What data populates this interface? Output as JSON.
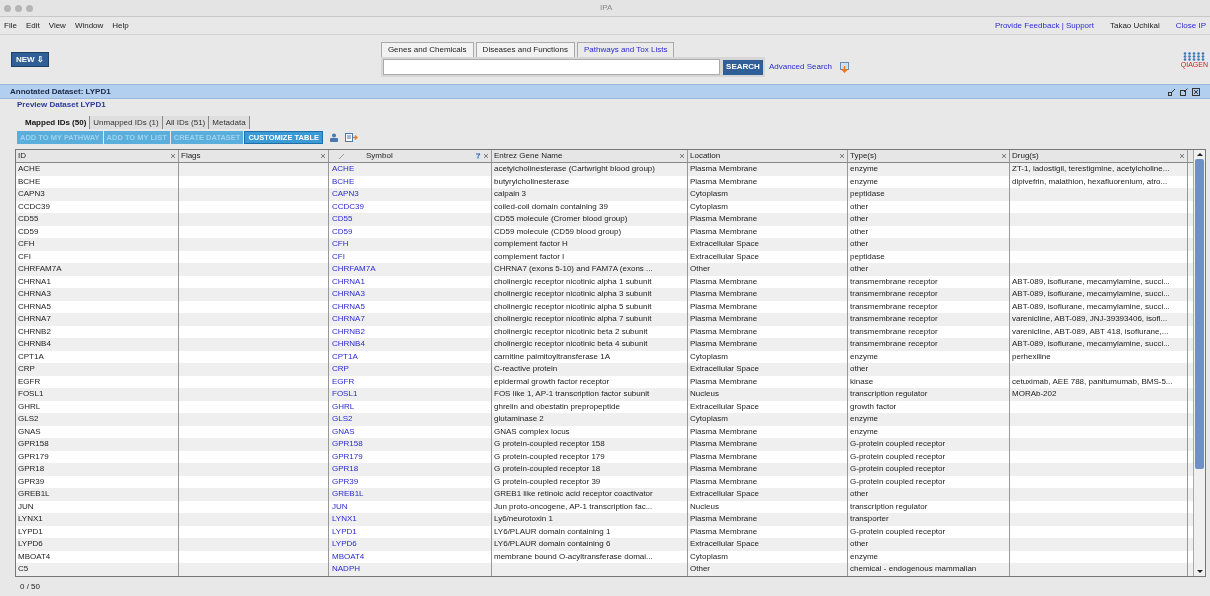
{
  "window": {
    "title": "IPA"
  },
  "menu": [
    "File",
    "Edit",
    "View",
    "Window",
    "Help"
  ],
  "top_links": [
    {
      "kind": "link",
      "label": "Provide Feedback | Support"
    },
    {
      "kind": "user",
      "label": "Takao Uchikai"
    },
    {
      "kind": "link",
      "label": "Close IP"
    }
  ],
  "new_button": "NEW ⇩",
  "search_tabs": [
    {
      "label": "Genes and Chemicals",
      "selected": false
    },
    {
      "label": "Diseases and Functions",
      "selected": false
    },
    {
      "label": "Pathways and Tox Lists",
      "selected": true
    }
  ],
  "search": {
    "button": "SEARCH",
    "advanced": "Advanced Search"
  },
  "logo_text": "QIAGEN",
  "panel": {
    "title": "Annotated Dataset: LYPD1",
    "preview_link": "Preview Dataset LYPD1"
  },
  "dataset_tabs": [
    {
      "label": "Mapped IDs (50)",
      "selected": true
    },
    {
      "label": "Unmapped IDs (1)",
      "selected": false
    },
    {
      "label": "All IDs (51)",
      "selected": false
    },
    {
      "label": "Metadata",
      "selected": false
    }
  ],
  "actions": [
    {
      "label": "ADD TO MY PATHWAY",
      "disabled": true
    },
    {
      "label": "ADD TO MY LIST",
      "disabled": true
    },
    {
      "label": "CREATE DATASET",
      "disabled": true
    },
    {
      "label": "CUSTOMIZE TABLE",
      "disabled": false
    }
  ],
  "table": {
    "columns": [
      "ID",
      "Flags",
      "Symbol",
      "Entrez Gene Name",
      "Location",
      "Type(s)",
      "Drug(s)"
    ],
    "rows": [
      {
        "id": "ACHE",
        "symbol": "ACHE",
        "name": "acetylcholinesterase (Cartwright blood group)",
        "location": "Plasma Membrane",
        "type": "enzyme",
        "drugs": "ZT-1, ladostigil, terestigmine, acetylcholine..."
      },
      {
        "id": "BCHE",
        "symbol": "BCHE",
        "name": "butyrylcholinesterase",
        "location": "Plasma Membrane",
        "type": "enzyme",
        "drugs": "dipivefrin, malathion, hexafluorenium, atro..."
      },
      {
        "id": "CAPN3",
        "symbol": "CAPN3",
        "name": "calpain 3",
        "location": "Cytoplasm",
        "type": "peptidase"
      },
      {
        "id": "CCDC39",
        "symbol": "CCDC39",
        "name": "coiled-coil domain containing 39",
        "location": "Cytoplasm",
        "type": "other"
      },
      {
        "id": "CD55",
        "symbol": "CD55",
        "name": "CD55 molecule (Cromer blood group)",
        "location": "Plasma Membrane",
        "type": "other"
      },
      {
        "id": "CD59",
        "symbol": "CD59",
        "name": "CD59 molecule (CD59 blood group)",
        "location": "Plasma Membrane",
        "type": "other"
      },
      {
        "id": "CFH",
        "symbol": "CFH",
        "name": "complement factor H",
        "location": "Extracellular Space",
        "type": "other"
      },
      {
        "id": "CFI",
        "symbol": "CFI",
        "name": "complement factor I",
        "location": "Extracellular Space",
        "type": "peptidase"
      },
      {
        "id": "CHRFAM7A",
        "symbol": "CHRFAM7A",
        "name": "CHRNA7 (exons 5-10) and FAM7A (exons ...",
        "location": "Other",
        "type": "other"
      },
      {
        "id": "CHRNA1",
        "symbol": "CHRNA1",
        "name": "cholinergic receptor nicotinic alpha 1 subunit",
        "location": "Plasma Membrane",
        "type": "transmembrane receptor",
        "drugs": "ABT-089, isoflurane, mecamylamine, succi..."
      },
      {
        "id": "CHRNA3",
        "symbol": "CHRNA3",
        "name": "cholinergic receptor nicotinic alpha 3 subunit",
        "location": "Plasma Membrane",
        "type": "transmembrane receptor",
        "drugs": "ABT-089, isoflurane, mecamylamine, succi..."
      },
      {
        "id": "CHRNA5",
        "symbol": "CHRNA5",
        "name": "cholinergic receptor nicotinic alpha 5 subunit",
        "location": "Plasma Membrane",
        "type": "transmembrane receptor",
        "drugs": "ABT-089, isoflurane, mecamylamine, succi..."
      },
      {
        "id": "CHRNA7",
        "symbol": "CHRNA7",
        "name": "cholinergic receptor nicotinic alpha 7 subunit",
        "location": "Plasma Membrane",
        "type": "transmembrane receptor",
        "drugs": "varenicline, ABT-089, JNJ-39393406, isofl..."
      },
      {
        "id": "CHRNB2",
        "symbol": "CHRNB2",
        "name": "cholinergic receptor nicotinic beta 2 subunit",
        "location": "Plasma Membrane",
        "type": "transmembrane receptor",
        "drugs": "varenicline, ABT-089, ABT 418, isoflurane,..."
      },
      {
        "id": "CHRNB4",
        "symbol": "CHRNB4",
        "name": "cholinergic receptor nicotinic beta 4 subunit",
        "location": "Plasma Membrane",
        "type": "transmembrane receptor",
        "drugs": "ABT-089, isoflurane, mecamylamine, succi..."
      },
      {
        "id": "CPT1A",
        "symbol": "CPT1A",
        "name": "carnitine palmitoyltransferase 1A",
        "location": "Cytoplasm",
        "type": "enzyme",
        "drugs": "perhexiline"
      },
      {
        "id": "CRP",
        "symbol": "CRP",
        "name": "C-reactive protein",
        "location": "Extracellular Space",
        "type": "other"
      },
      {
        "id": "EGFR",
        "symbol": "EGFR",
        "name": "epidermal growth factor receptor",
        "location": "Plasma Membrane",
        "type": "kinase",
        "drugs": "cetuximab, AEE 788, panitumumab, BMS-5..."
      },
      {
        "id": "FOSL1",
        "symbol": "FOSL1",
        "name": "FOS like 1, AP-1 transcription factor subunit",
        "location": "Nucleus",
        "type": "transcription regulator",
        "drugs": "MORAb-202"
      },
      {
        "id": "GHRL",
        "symbol": "GHRL",
        "name": "ghrelin and obestatin prepropeptide",
        "location": "Extracellular Space",
        "type": "growth factor"
      },
      {
        "id": "GLS2",
        "symbol": "GLS2",
        "name": "glutaminase 2",
        "location": "Cytoplasm",
        "type": "enzyme"
      },
      {
        "id": "GNAS",
        "symbol": "GNAS",
        "name": "GNAS complex locus",
        "location": "Plasma Membrane",
        "type": "enzyme"
      },
      {
        "id": "GPR158",
        "symbol": "GPR158",
        "name": "G protein-coupled receptor 158",
        "location": "Plasma Membrane",
        "type": "G-protein coupled receptor"
      },
      {
        "id": "GPR179",
        "symbol": "GPR179",
        "name": "G protein-coupled receptor 179",
        "location": "Plasma Membrane",
        "type": "G-protein coupled receptor"
      },
      {
        "id": "GPR18",
        "symbol": "GPR18",
        "name": "G protein-coupled receptor 18",
        "location": "Plasma Membrane",
        "type": "G-protein coupled receptor"
      },
      {
        "id": "GPR39",
        "symbol": "GPR39",
        "name": "G protein-coupled receptor 39",
        "location": "Plasma Membrane",
        "type": "G-protein coupled receptor"
      },
      {
        "id": "GREB1L",
        "symbol": "GREB1L",
        "name": "GREB1 like retinoic acid receptor coactivator",
        "location": "Extracellular Space",
        "type": "other"
      },
      {
        "id": "JUN",
        "symbol": "JUN",
        "name": "Jun proto-oncogene, AP-1 transcription fac...",
        "location": "Nucleus",
        "type": "transcription regulator"
      },
      {
        "id": "LYNX1",
        "symbol": "LYNX1",
        "name": "Ly6/neurotoxin 1",
        "location": "Plasma Membrane",
        "type": "transporter"
      },
      {
        "id": "LYPD1",
        "symbol": "LYPD1",
        "name": "LY6/PLAUR domain containing 1",
        "location": "Plasma Membrane",
        "type": "G-protein coupled receptor"
      },
      {
        "id": "LYPD6",
        "symbol": "LYPD6",
        "name": "LY6/PLAUR domain containing 6",
        "location": "Extracellular Space",
        "type": "other"
      },
      {
        "id": "MBOAT4",
        "symbol": "MBOAT4",
        "name": "membrane bound O-acyltransferase domai...",
        "location": "Cytoplasm",
        "type": "enzyme"
      },
      {
        "id": "C5",
        "symbol": "NADPH",
        "location": "Other",
        "type": "chemical - endogenous mammalian"
      }
    ]
  },
  "status": "0 / 50"
}
